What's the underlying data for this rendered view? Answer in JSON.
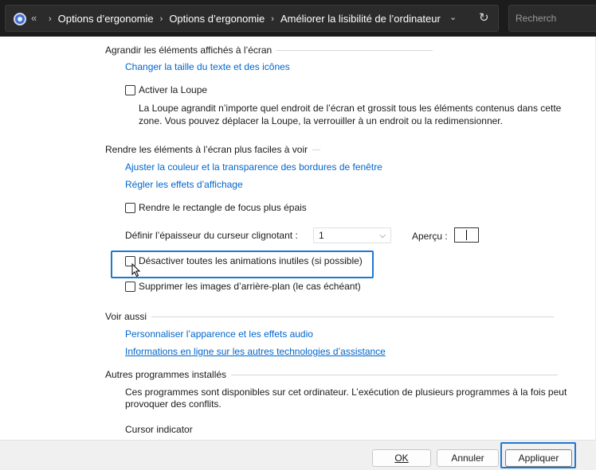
{
  "address_bar": {
    "breadcrumbs": [
      "Options d’ergonomie",
      "Options d’ergonomie",
      "Améliorer la lisibilité de l’ordinateur"
    ],
    "more_glyph": "«",
    "separator": "›",
    "search_placeholder": "Recherch"
  },
  "section1": {
    "heading": "Agrandir les éléments affichés à l’écran",
    "link": "Changer la taille du texte et des icônes",
    "checkbox_label": "Activer la Loupe",
    "checked": false,
    "description": "La Loupe agrandit n’importe quel endroit de l’écran et grossit tous les éléments contenus dans cette zone. Vous pouvez déplacer la Loupe, la verrouiller à un endroit ou la redimensionner."
  },
  "section2": {
    "heading": "Rendre les éléments à l’écran plus faciles à voir",
    "link1": "Ajuster la couleur et la transparence des bordures de fenêtre",
    "link2": "Régler les effets d’affichage",
    "focus_checkbox": "Rendre le rectangle de focus plus épais",
    "cursor_label": "Définir l’épaisseur du curseur clignotant :",
    "cursor_value": "1",
    "preview_label": "Aperçu :",
    "animations_checkbox": "Désactiver toutes les animations inutiles (si possible)",
    "background_checkbox": "Supprimer les images d’arrière-plan (le cas échéant)"
  },
  "section3": {
    "heading": "Voir aussi",
    "link1": "Personnaliser l’apparence et les effets audio",
    "link2": "Informations en ligne sur les autres technologies d’assistance"
  },
  "section4": {
    "heading": "Autres programmes installés",
    "description": "Ces programmes sont disponibles sur cet ordinateur. L’exécution de plusieurs programmes à la fois peut provoquer des conflits.",
    "program": "Cursor indicator"
  },
  "footer": {
    "ok_label": "OK",
    "cancel_label": "Annuler",
    "apply_label": "Appliquer"
  },
  "colors": {
    "link": "#0066cc",
    "highlight": "#1e78d2",
    "titlebar": "#1c1c1c"
  }
}
